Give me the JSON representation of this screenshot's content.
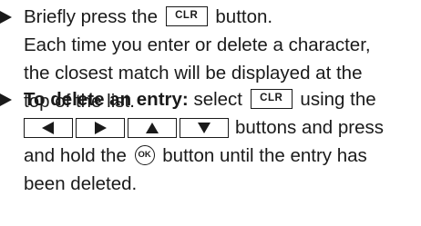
{
  "instructions": [
    {
      "lines": [
        [
          "Briefly press the",
          "CLR",
          "button."
        ],
        "Each time you enter or delete a character,",
        "the closest match will be displayed at the",
        "top of the list."
      ]
    },
    {
      "lines": [
        [
          "To delete an entry:",
          "select",
          "CLR",
          "using the"
        ],
        [
          "buttons and press"
        ],
        [
          "and hold the",
          "OK",
          "button until the entry has"
        ],
        "been deleted."
      ]
    }
  ],
  "icons": {
    "bullet": "triangle-right-icon",
    "arrow_keys": [
      "left-arrow-icon",
      "right-arrow-icon",
      "up-arrow-icon",
      "down-arrow-icon"
    ]
  },
  "colors": {
    "text": "#1a1a1a",
    "background": "#ffffff"
  }
}
